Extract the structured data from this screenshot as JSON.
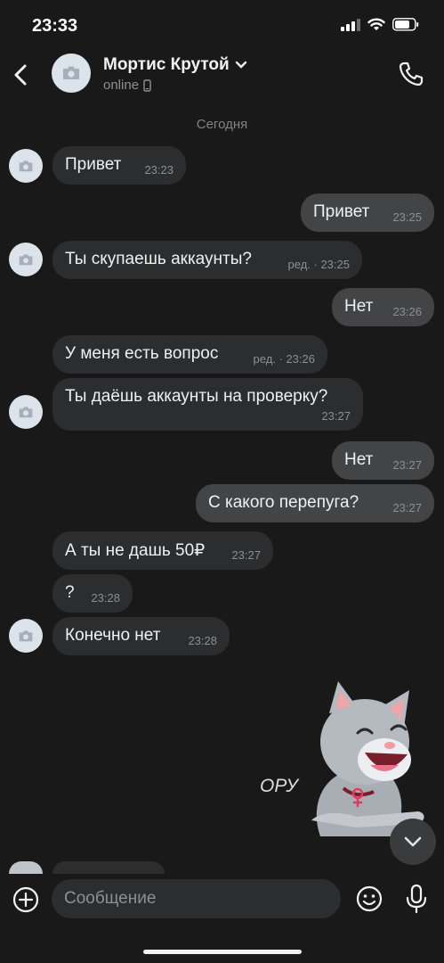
{
  "status_bar": {
    "time": "23:33"
  },
  "header": {
    "name": "Мортис Крутой",
    "status": "online"
  },
  "date_separator": "Сегодня",
  "messages": [
    {
      "text": "Привет",
      "meta": "23:23"
    },
    {
      "text": "Привет",
      "meta": "23:25"
    },
    {
      "text": "Ты скупаешь аккаунты?",
      "meta": "ред. · 23:25"
    },
    {
      "text": "Нет",
      "meta": "23:26"
    },
    {
      "text": "У меня есть вопрос",
      "meta": "ред. · 23:26"
    },
    {
      "text": "Ты даёшь аккаунты на проверку?",
      "meta": "23:27"
    },
    {
      "text": "Нет",
      "meta": "23:27"
    },
    {
      "text": "С какого перепуга?",
      "meta": "23:27"
    },
    {
      "text": "А ты не дашь 50₽",
      "meta": "23:27"
    },
    {
      "text": "?",
      "meta": "23:28"
    },
    {
      "text": "Конечно нет",
      "meta": "23:28"
    }
  ],
  "sticker": {
    "caption": "ОРУ"
  },
  "composer": {
    "placeholder": "Сообщение"
  },
  "colors": {
    "background": "#19191a",
    "incoming_bubble": "#2c2d2e",
    "outgoing_bubble": "#434446",
    "secondary_text": "#8d8f93"
  }
}
